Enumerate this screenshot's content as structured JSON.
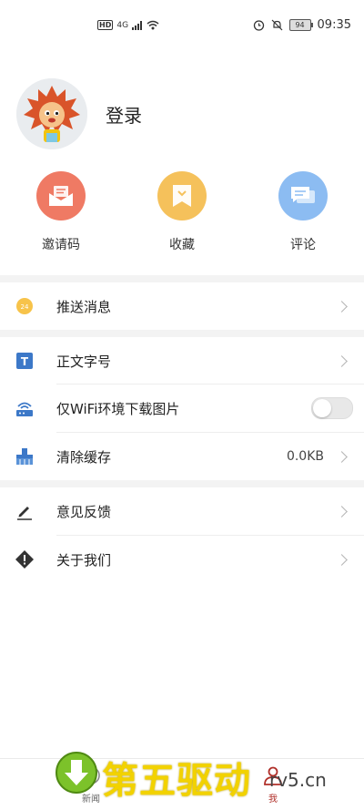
{
  "status_bar": {
    "network": "HD",
    "signal": "4G",
    "battery": "94",
    "time": "09:35"
  },
  "profile": {
    "login_label": "登录"
  },
  "quick_actions": [
    {
      "label": "邀请码",
      "icon": "envelope-icon",
      "color": "#ef7a64"
    },
    {
      "label": "收藏",
      "icon": "bookmark-icon",
      "color": "#f5c15b"
    },
    {
      "label": "评论",
      "icon": "comment-icon",
      "color": "#8cbcf2"
    }
  ],
  "settings": {
    "push": {
      "label": "推送消息"
    },
    "font_size": {
      "label": "正文字号"
    },
    "wifi_images": {
      "label": "仅WiFi环境下载图片",
      "enabled": false
    },
    "clear_cache": {
      "label": "清除缓存",
      "value": "0.0KB"
    },
    "feedback": {
      "label": "意见反馈"
    },
    "about": {
      "label": "关于我们"
    }
  },
  "bottom_nav": [
    {
      "label": "新闻",
      "active": false
    },
    {
      "label": "我",
      "active": true,
      "color": "#b0302a"
    }
  ],
  "watermark": {
    "text": "第五驱动",
    "url": "rv5.cn"
  }
}
